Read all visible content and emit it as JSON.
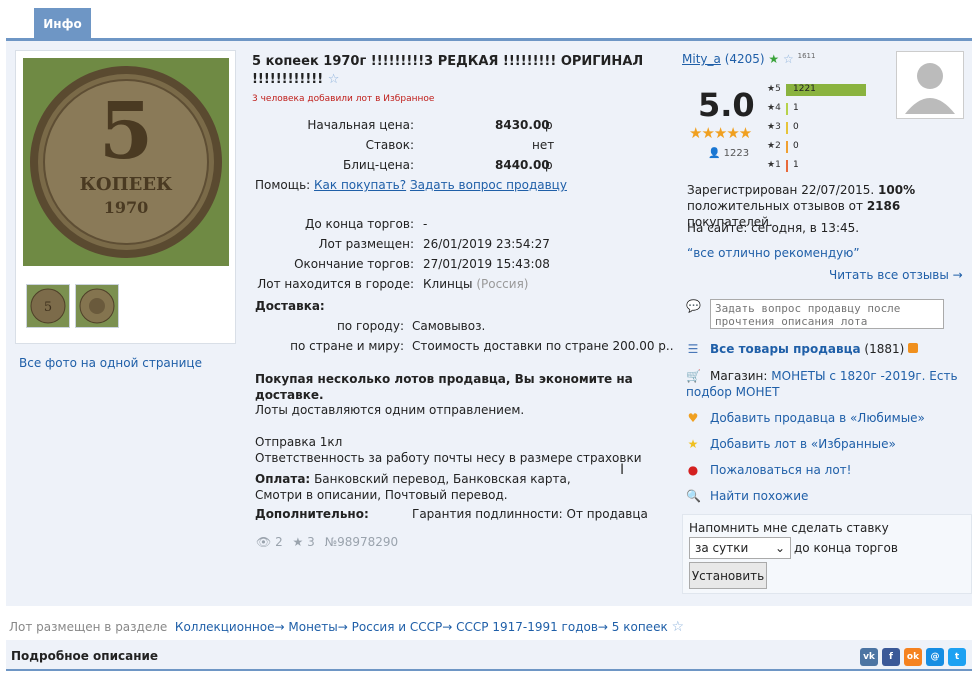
{
  "tab": {
    "label": "Инфо"
  },
  "photos": {
    "all_link": "Все фото на одной странице",
    "coin_text_top": "5",
    "coin_text_mid": "КОПЕЕК",
    "coin_text_year": "1970"
  },
  "lot": {
    "title": "5 копеек 1970г !!!!!!!!!3 РЕДКАЯ !!!!!!!!! ОРИГИНАЛ !!!!!!!!!!!!",
    "favorites_note": "3 человека добавили лот в Избранное",
    "start_price_label": "Начальная цена:",
    "start_price": "8430.00",
    "bids_label": "Ставок:",
    "bids": "нет",
    "blitz_label": "Блиц-цена:",
    "blitz": "8440.00",
    "currency": "р",
    "help_label": "Помощь:",
    "help_link1": "Как покупать?",
    "help_link2": "Задать вопрос продавцу",
    "time_left_label": "До конца торгов:",
    "time_left": "-",
    "placed_label": "Лот размещен:",
    "placed": "26/01/2019 23:54:27",
    "end_label": "Окончание торгов:",
    "end": "27/01/2019 15:43:08",
    "city_label": "Лот находится в городе:",
    "city": "Клинцы",
    "country": "(Россия)",
    "delivery_label": "Доставка:",
    "city_delivery_label": "по городу:",
    "city_delivery": "Самовывоз.",
    "world_delivery_label": "по стране и миру:",
    "world_delivery": "Стоимость доставки по стране 200.00 р..",
    "save_bold": "Покупая несколько лотов продавца, Вы экономите на доставке.",
    "save_text": "Лоты доставляются одним отправлением.",
    "shipping_1": "Отправка 1кл",
    "shipping_2": "Ответственность за работу почты несу в размере страховки",
    "payment_label": "Оплата:",
    "payment": "Банковский перевод, Банковская карта, Смотри в описании, Почтовый перевод.",
    "extra_label": "Дополнительно:",
    "extra": "Гарантия подлинности: От продавца",
    "views": "2",
    "stars": "3",
    "number": "№98978290"
  },
  "seller": {
    "name": "Mity_a",
    "rating_count": "(4205)",
    "star_count": "1611",
    "score": "5.0",
    "reviewers": "1223",
    "rows": [
      {
        "label": "5",
        "count": "1221",
        "frac": 1.0,
        "color": "#8ab33f"
      },
      {
        "label": "4",
        "count": "1",
        "frac": 0.005,
        "color": "#b7d24b"
      },
      {
        "label": "3",
        "count": "0",
        "frac": 0.005,
        "color": "#e6c43a"
      },
      {
        "label": "2",
        "count": "0",
        "frac": 0.005,
        "color": "#f0a030"
      },
      {
        "label": "1",
        "count": "1",
        "frac": 0.005,
        "color": "#e8693a"
      }
    ],
    "reg_text": "Зарегистрирован 22/07/2015.",
    "pos_pct": "100%",
    "pos_text": "положительных отзывов от",
    "buyers": "2186",
    "buyers_suffix": "покупателей.",
    "online": "На сайте: сегодня, в 13:45.",
    "quote": "“все отлично рекомендую”",
    "all_reviews": "Читать все отзывы →",
    "ask_placeholder": "Задать вопрос продавцу после прочтения описания лота",
    "all_goods": "Все товары продавца",
    "all_goods_count": "(1881)",
    "shop_label": "Магазин:",
    "shop_name": "МОНЕТЫ с 1820г -2019г. Есть подбор МОНЕТ",
    "fav_seller": "Добавить продавца в «Любимые»",
    "fav_lot": "Добавить лот в «Избранные»",
    "complain": "Пожаловаться на лот!",
    "similar": "Найти похожие"
  },
  "remind": {
    "title": "Напомнить мне сделать ставку",
    "select": "за сутки",
    "suffix": "до конца торгов",
    "button": "Установить"
  },
  "breadcrumb": {
    "prefix": "Лот размещен в разделе",
    "items": [
      "Коллекционное→",
      "Монеты→",
      "Россия и СССР→",
      "СССР 1917-1991 годов→",
      "5 копеек"
    ]
  },
  "footer": {
    "title": "Подробное описание"
  },
  "colors": {
    "accent": "#6e96c5",
    "panel": "#eef2f9",
    "link": "#1f5fa8",
    "red": "#c0201c"
  }
}
